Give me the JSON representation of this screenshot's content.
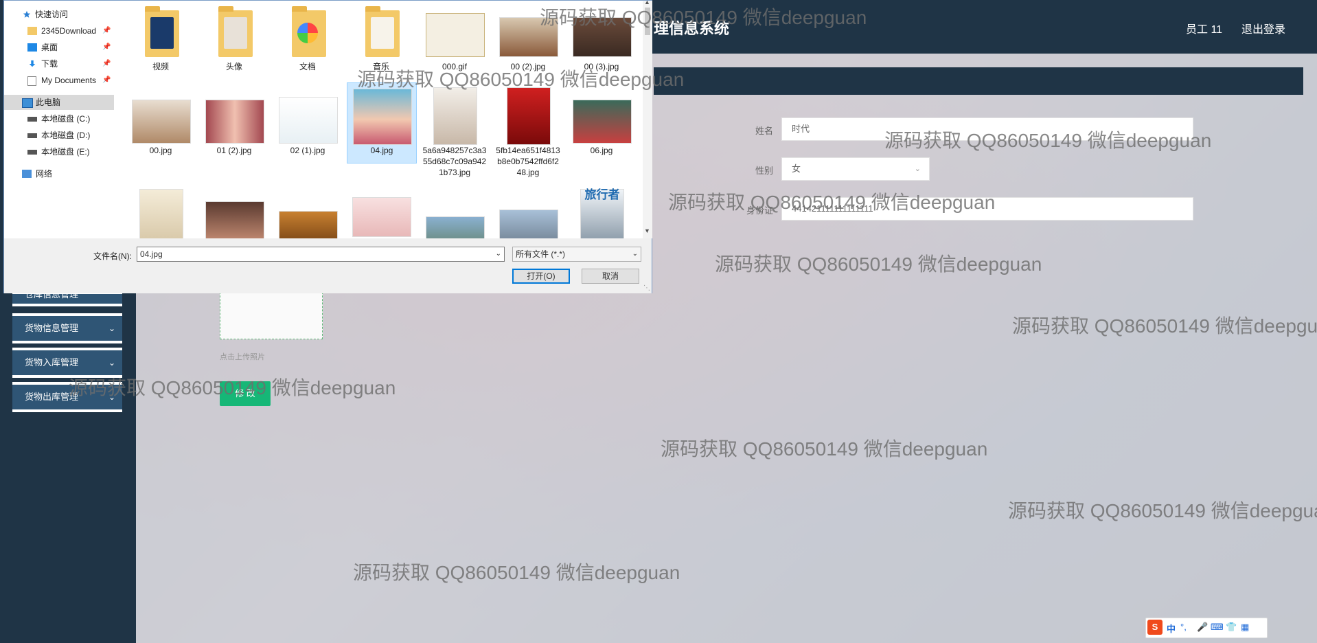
{
  "app": {
    "title_partial": "理信息系统",
    "user": "员工 11",
    "logout": "退出登录"
  },
  "sidebar": {
    "items": [
      {
        "label": "仓库信息管理"
      },
      {
        "label": "货物信息管理"
      },
      {
        "label": "货物入库管理"
      },
      {
        "label": "货物出库管理"
      }
    ]
  },
  "form": {
    "name_label": "姓名",
    "name_value": "时代",
    "gender_label": "性别",
    "gender_value": "女",
    "id_label": "身份证",
    "id_value": "441421111111111111",
    "upload_tip": "点击上传照片",
    "submit_label": "修 改"
  },
  "dialog": {
    "nav": [
      {
        "label": "快速访问",
        "icon": "star-icon",
        "pinned": false
      },
      {
        "label": "2345Download",
        "icon": "folder-icon",
        "pinned": true
      },
      {
        "label": "桌面",
        "icon": "desktop-icon",
        "pinned": true
      },
      {
        "label": "下载",
        "icon": "download-icon",
        "pinned": true
      },
      {
        "label": "My Documents",
        "icon": "documents-icon",
        "pinned": true
      },
      {
        "label": "此电脑",
        "icon": "computer-icon",
        "pinned": false
      },
      {
        "label": "本地磁盘 (C:)",
        "icon": "drive-icon",
        "pinned": false
      },
      {
        "label": "本地磁盘 (D:)",
        "icon": "drive-icon",
        "pinned": false
      },
      {
        "label": "本地磁盘 (E:)",
        "icon": "drive-icon",
        "pinned": false
      },
      {
        "label": "网络",
        "icon": "network-icon",
        "pinned": false
      }
    ],
    "files": [
      {
        "name": "视频",
        "kind": "folder"
      },
      {
        "name": "头像",
        "kind": "folder"
      },
      {
        "name": "文档",
        "kind": "folder"
      },
      {
        "name": "音乐",
        "kind": "folder"
      },
      {
        "name": "000.gif",
        "kind": "image"
      },
      {
        "name": "00 (2).jpg",
        "kind": "image"
      },
      {
        "name": "00 (3).jpg",
        "kind": "image"
      },
      {
        "name": "00.jpg",
        "kind": "image"
      },
      {
        "name": "01 (2).jpg",
        "kind": "image"
      },
      {
        "name": "02 (1).jpg",
        "kind": "image"
      },
      {
        "name": "04.jpg",
        "kind": "image"
      },
      {
        "name": "5a6a948257c3a355d68c7c09a9421b73.jpg",
        "kind": "image"
      },
      {
        "name": "5fb14ea651f4813b8e0b7542ffd6f248.jpg",
        "kind": "image"
      },
      {
        "name": "06.jpg",
        "kind": "image"
      },
      {
        "name": "",
        "kind": "image"
      },
      {
        "name": "",
        "kind": "image"
      },
      {
        "name": "",
        "kind": "image"
      },
      {
        "name": "",
        "kind": "image"
      },
      {
        "name": "",
        "kind": "image"
      },
      {
        "name": "",
        "kind": "image"
      },
      {
        "name": "",
        "kind": "image"
      }
    ],
    "selected_file": "04.jpg",
    "book_cover_text": "旅行者",
    "filename_label": "文件名(N):",
    "filename_value": "04.jpg",
    "filetype_value": "所有文件 (*.*)",
    "open_label": "打开(O)",
    "cancel_label": "取消"
  },
  "watermark_text": "源码获取 QQ86050149 微信deepguan",
  "tray": {
    "ime_lang": "中",
    "ime_punct": "°,"
  },
  "colors": {
    "header_bg": "#1f3446",
    "sidebar_item_bg": "#2f5575",
    "submit_button": "#16b777",
    "selection": "#cce8ff"
  }
}
